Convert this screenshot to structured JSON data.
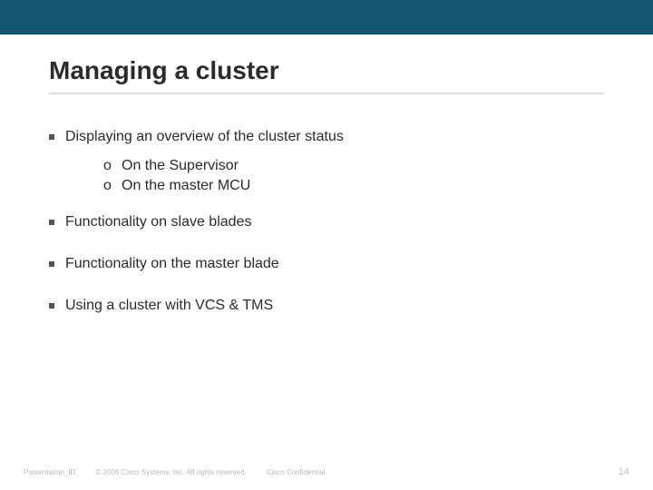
{
  "title": "Managing a cluster",
  "bullets": {
    "b0": "Displaying an overview of the cluster status",
    "b1": "Functionality on slave blades",
    "b2": "Functionality on the master blade",
    "b3": "Using a cluster with VCS & TMS"
  },
  "sub": {
    "s0": "On the Supervisor",
    "s1": "On the master MCU"
  },
  "omark": "o",
  "footer": {
    "presentation_id": "Presentation_ID",
    "copyright": "© 2006 Cisco Systems, Inc. All rights reserved.",
    "confidential": "Cisco Confidential",
    "page": "14"
  }
}
